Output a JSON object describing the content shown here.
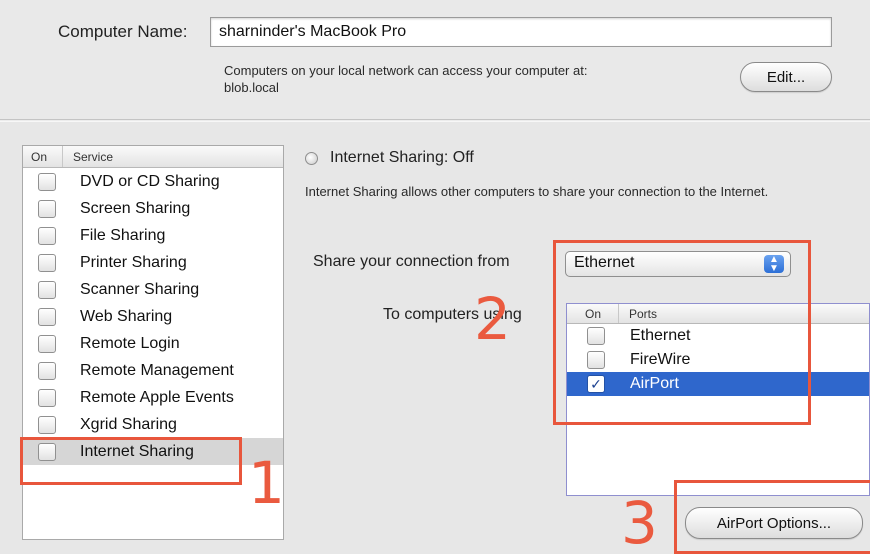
{
  "computer_name": {
    "label": "Computer Name:",
    "value": "sharninder's MacBook Pro",
    "description_line1": "Computers on your local network can access your computer at:",
    "description_line2": "blob.local",
    "edit_button": "Edit..."
  },
  "services": {
    "header_on": "On",
    "header_service": "Service",
    "items": [
      {
        "label": "DVD or CD Sharing",
        "checked": false
      },
      {
        "label": "Screen Sharing",
        "checked": false
      },
      {
        "label": "File Sharing",
        "checked": false
      },
      {
        "label": "Printer Sharing",
        "checked": false
      },
      {
        "label": "Scanner Sharing",
        "checked": false
      },
      {
        "label": "Web Sharing",
        "checked": false
      },
      {
        "label": "Remote Login",
        "checked": false
      },
      {
        "label": "Remote Management",
        "checked": false
      },
      {
        "label": "Remote Apple Events",
        "checked": false
      },
      {
        "label": "Xgrid Sharing",
        "checked": false
      },
      {
        "label": "Internet Sharing",
        "checked": false,
        "selected": true
      }
    ]
  },
  "internet_sharing": {
    "status": "Internet Sharing: Off",
    "description": "Internet Sharing allows other computers to share your connection to the Internet.",
    "share_from_label": "Share your connection from",
    "share_from_value": "Ethernet",
    "to_computers_label": "To computers using",
    "ports_header_on": "On",
    "ports_header_ports": "Ports",
    "ports": [
      {
        "label": "Ethernet",
        "checked": false
      },
      {
        "label": "FireWire",
        "checked": false
      },
      {
        "label": "AirPort",
        "checked": true,
        "selected": true
      }
    ],
    "airport_options_button": "AirPort Options..."
  },
  "annotations": {
    "step1": "1",
    "step2": "2",
    "step3": "3",
    "color": "#e8563c"
  },
  "icons": {
    "select_arrows": "up-down-arrows-icon",
    "checkmark": "checkmark-icon"
  }
}
